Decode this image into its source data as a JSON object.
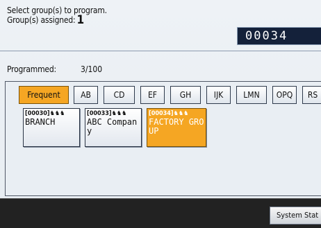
{
  "header": {
    "instruction": "Select group(s) to program.",
    "assigned_label": "Group(s) assigned:",
    "assigned_count": "1",
    "number_display": "00034"
  },
  "programmed": {
    "label": "Programmed:",
    "value": "3/100"
  },
  "tabs": [
    {
      "label": "Frequent",
      "active": true
    },
    {
      "label": "AB"
    },
    {
      "label": "CD"
    },
    {
      "label": "EF"
    },
    {
      "label": "GH"
    },
    {
      "label": "IJK"
    },
    {
      "label": "LMN"
    },
    {
      "label": "OPQ"
    },
    {
      "label": "RS"
    }
  ],
  "entries": [
    {
      "number": "[00030]",
      "icon": "group-icon",
      "name": "BRANCH",
      "selected": false
    },
    {
      "number": "[00033]",
      "icon": "group-icon",
      "name": "ABC Company",
      "selected": false
    },
    {
      "number": "[00034]",
      "icon": "group-icon",
      "name": "FACTORY GROUP",
      "selected": true
    }
  ],
  "footer": {
    "system_status": "System Stat"
  },
  "colors": {
    "selected": "#f5a623",
    "display_bg": "#14213a",
    "footer_bg": "#222222"
  }
}
